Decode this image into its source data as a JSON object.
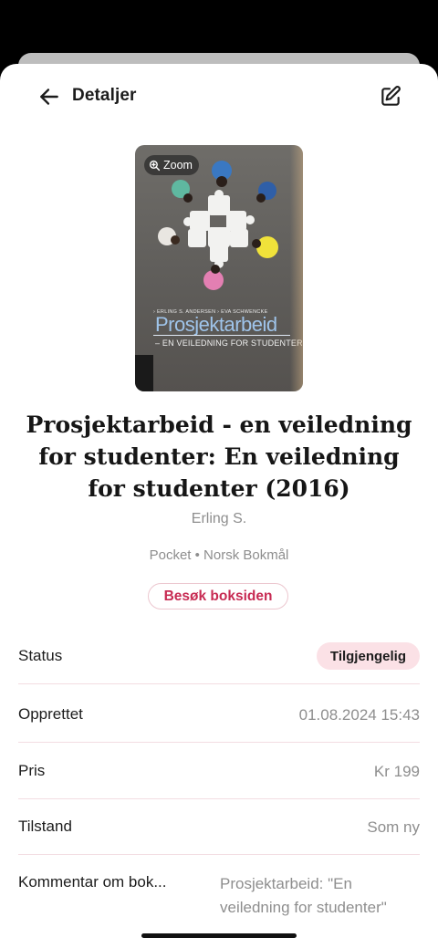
{
  "header": {
    "title": "Detaljer",
    "back_icon": "arrow-left-icon",
    "edit_icon": "edit-icon"
  },
  "cover": {
    "zoom_label": "Zoom",
    "authors": "› ERLING S. ANDERSEN  › EVA SCHWENCKE",
    "title": "Prosjektarbeid",
    "subtitle": "– EN VEILEDNING FOR STUDENTER"
  },
  "book": {
    "title": "Prosjektarbeid - en veiledning for studenter: En veiledning for studenter (2016)",
    "author": "Erling S.",
    "meta": "Pocket • Norsk Bokmål",
    "visit_label": "Besøk boksiden"
  },
  "details": {
    "status_label": "Status",
    "status_value": "Tilgjengelig",
    "created_label": "Opprettet",
    "created_value": "01.08.2024 15:43",
    "price_label": "Pris",
    "price_value": "Kr 199",
    "condition_label": "Tilstand",
    "condition_value": "Som ny",
    "comment_label": "Kommentar om bok...",
    "comment_value": "Prosjektarbeid: \"En veiledning for studenter\""
  },
  "colors": {
    "accent": "#c72a52",
    "status_bg": "#fbe1e6",
    "divider": "#f3dde2"
  }
}
